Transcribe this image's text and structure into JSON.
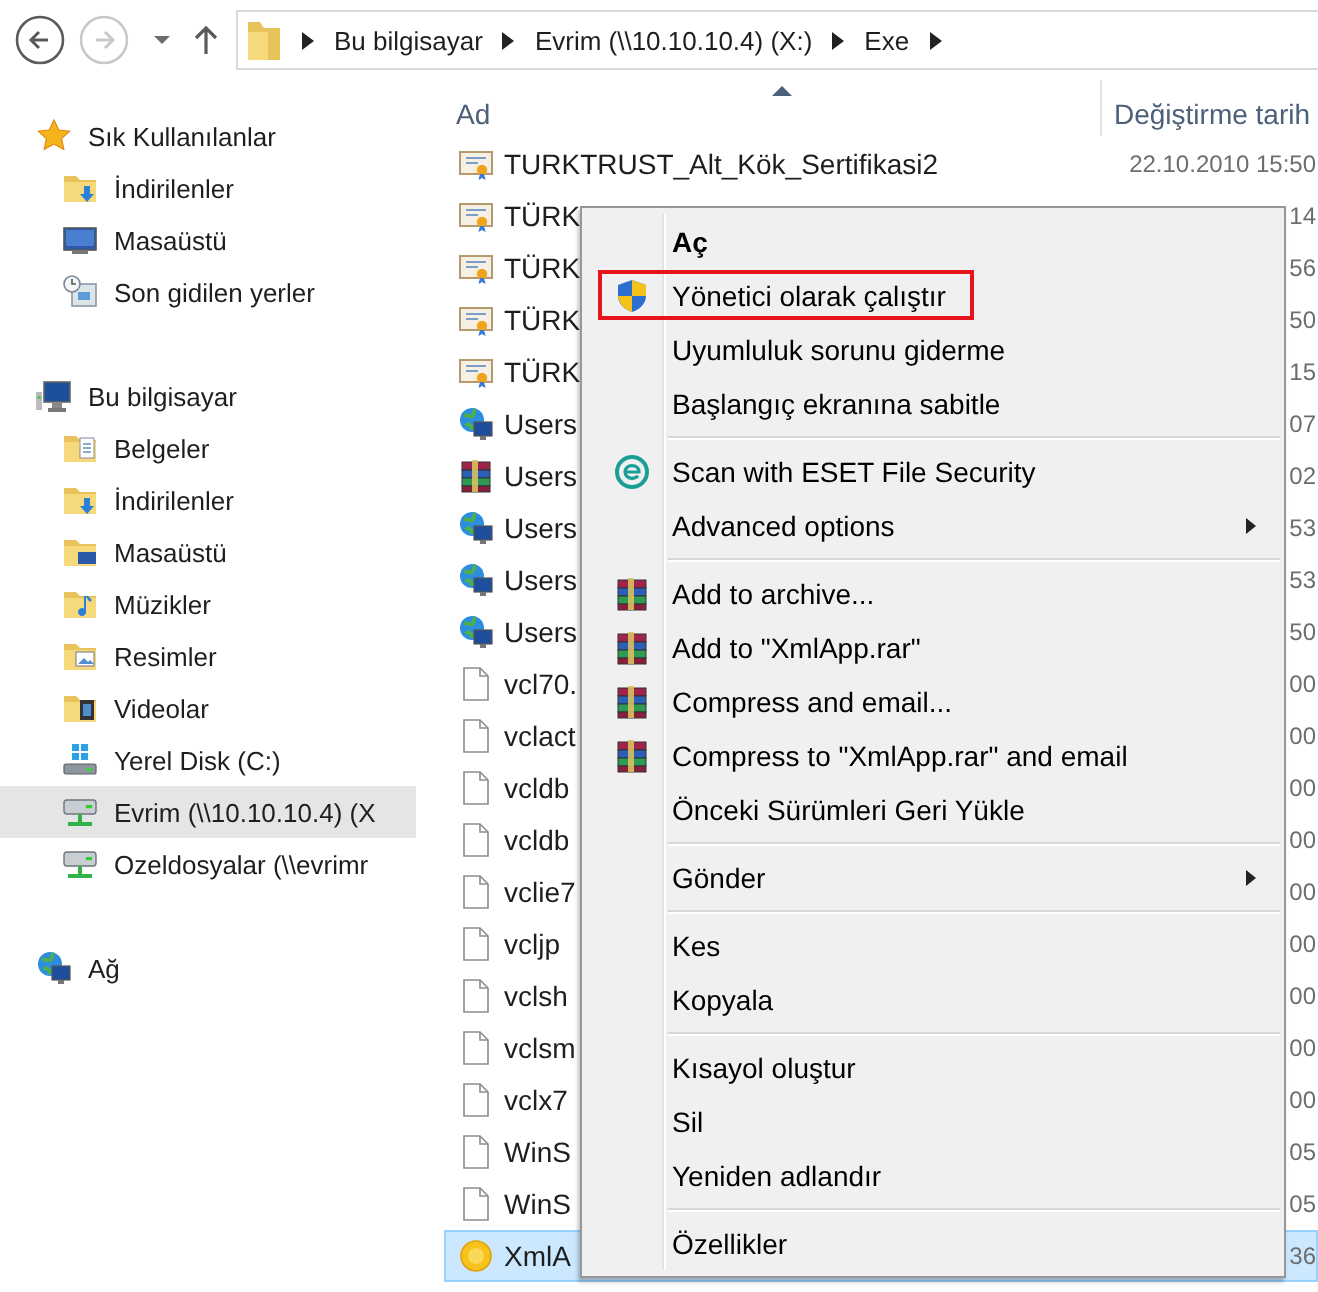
{
  "toolbar": {
    "nav": [
      {
        "kind": "back",
        "disabled": false
      },
      {
        "kind": "forward",
        "disabled": true
      }
    ],
    "address": {
      "crumbs": [
        "Bu bilgisayar",
        "Evrim (\\\\10.10.10.4) (X:)",
        "Exe"
      ]
    }
  },
  "sidebar": {
    "groups": [
      {
        "label": "Sık Kullanılanlar",
        "kind": "star",
        "selected": false,
        "children": [
          {
            "label": "İndirilenler",
            "kind": "downloads",
            "selected": false
          },
          {
            "label": "Masaüstü",
            "kind": "desktop",
            "selected": false
          },
          {
            "label": "Son gidilen yerler",
            "kind": "recent",
            "selected": false
          }
        ]
      },
      {
        "label": "Bu bilgisayar",
        "kind": "computer",
        "selected": false,
        "children": [
          {
            "label": "Belgeler",
            "kind": "documents",
            "selected": false
          },
          {
            "label": "İndirilenler",
            "kind": "downloads",
            "selected": false
          },
          {
            "label": "Masaüstü",
            "kind": "desktopfolder",
            "selected": false
          },
          {
            "label": "Müzikler",
            "kind": "music",
            "selected": false
          },
          {
            "label": "Resimler",
            "kind": "pictures",
            "selected": false
          },
          {
            "label": "Videolar",
            "kind": "videos",
            "selected": false
          },
          {
            "label": "Yerel Disk (C:)",
            "kind": "disk",
            "selected": false
          },
          {
            "label": "Evrim (\\\\10.10.10.4) (X",
            "kind": "netdrive",
            "selected": true
          },
          {
            "label": "Ozeldosyalar (\\\\evrimr",
            "kind": "netdrive",
            "selected": false
          }
        ]
      },
      {
        "label": "Ağ",
        "kind": "network",
        "selected": false
      }
    ]
  },
  "files": {
    "columns": [
      {
        "label": "Ad",
        "sorted": true
      },
      {
        "label": "Değiştirme tarih",
        "sorted": false
      }
    ],
    "rows": [
      {
        "name": "TURKTRUST_Alt_Kök_Sertifikasi2",
        "date": "22.10.2010 15:50",
        "kind": "cert",
        "selected": false
      },
      {
        "name": "TÜRK",
        "date": "14",
        "kind": "cert",
        "selected": false
      },
      {
        "name": "TÜRK",
        "date": "56",
        "kind": "cert",
        "selected": false
      },
      {
        "name": "TÜRK",
        "date": "50",
        "kind": "cert",
        "selected": false
      },
      {
        "name": "TÜRK",
        "date": "15",
        "kind": "cert",
        "selected": false
      },
      {
        "name": "Users",
        "date": "07",
        "kind": "network",
        "selected": false
      },
      {
        "name": "Users",
        "date": "02",
        "kind": "rar",
        "selected": false
      },
      {
        "name": "Users",
        "date": "53",
        "kind": "network",
        "selected": false
      },
      {
        "name": "Users",
        "date": "53",
        "kind": "network",
        "selected": false
      },
      {
        "name": "Users",
        "date": "50",
        "kind": "network",
        "selected": false
      },
      {
        "name": "vcl70.",
        "date": "00",
        "kind": "file",
        "selected": false
      },
      {
        "name": "vclact",
        "date": "00",
        "kind": "file",
        "selected": false
      },
      {
        "name": "vcldb",
        "date": "00",
        "kind": "file",
        "selected": false
      },
      {
        "name": "vcldb",
        "date": "00",
        "kind": "file",
        "selected": false
      },
      {
        "name": "vclie7",
        "date": "00",
        "kind": "file",
        "selected": false
      },
      {
        "name": "vcljp",
        "date": "00",
        "kind": "file",
        "selected": false
      },
      {
        "name": "vclsh",
        "date": "00",
        "kind": "file",
        "selected": false
      },
      {
        "name": "vclsm",
        "date": "00",
        "kind": "file",
        "selected": false
      },
      {
        "name": "vclx7",
        "date": "00",
        "kind": "file",
        "selected": false
      },
      {
        "name": "WinS",
        "date": "05",
        "kind": "file",
        "selected": false
      },
      {
        "name": "WinS",
        "date": "05",
        "kind": "file",
        "selected": false
      },
      {
        "name": "XmlA",
        "date": "36",
        "kind": "xml",
        "selected": true
      }
    ]
  },
  "menu": {
    "items": [
      {
        "kind": "plain",
        "label": "Aç",
        "default": true,
        "submenu": false,
        "highlighted": false
      },
      {
        "kind": "shield",
        "label": "Yönetici olarak çalıştır",
        "default": false,
        "submenu": false,
        "highlighted": true
      },
      {
        "kind": "plain",
        "label": "Uyumluluk sorunu giderme",
        "default": false,
        "submenu": false,
        "highlighted": false
      },
      {
        "kind": "plain",
        "label": "Başlangıç ekranına sabitle",
        "default": false,
        "submenu": false,
        "highlighted": false
      },
      {
        "kind": "separator"
      },
      {
        "kind": "eset",
        "label": "Scan with ESET File Security",
        "default": false,
        "submenu": false,
        "highlighted": false
      },
      {
        "kind": "plain",
        "label": "Advanced options",
        "default": false,
        "submenu": true,
        "highlighted": false
      },
      {
        "kind": "separator"
      },
      {
        "kind": "rar",
        "label": "Add to archive...",
        "default": false,
        "submenu": false,
        "highlighted": false
      },
      {
        "kind": "rar",
        "label": "Add to \"XmlApp.rar\"",
        "default": false,
        "submenu": false,
        "highlighted": false
      },
      {
        "kind": "rar",
        "label": "Compress and email...",
        "default": false,
        "submenu": false,
        "highlighted": false
      },
      {
        "kind": "rar",
        "label": "Compress to \"XmlApp.rar\" and email",
        "default": false,
        "submenu": false,
        "highlighted": false
      },
      {
        "kind": "plain",
        "label": "Önceki Sürümleri Geri Yükle",
        "default": false,
        "submenu": false,
        "highlighted": false
      },
      {
        "kind": "separator"
      },
      {
        "kind": "plain",
        "label": "Gönder",
        "default": false,
        "submenu": true,
        "highlighted": false
      },
      {
        "kind": "separator"
      },
      {
        "kind": "plain",
        "label": "Kes",
        "default": false,
        "submenu": false,
        "highlighted": false
      },
      {
        "kind": "plain",
        "label": "Kopyala",
        "default": false,
        "submenu": false,
        "highlighted": false
      },
      {
        "kind": "separator"
      },
      {
        "kind": "plain",
        "label": "Kısayol oluştur",
        "default": false,
        "submenu": false,
        "highlighted": false
      },
      {
        "kind": "plain",
        "label": "Sil",
        "default": false,
        "submenu": false,
        "highlighted": false
      },
      {
        "kind": "plain",
        "label": "Yeniden adlandır",
        "default": false,
        "submenu": false,
        "highlighted": false
      },
      {
        "kind": "separator"
      },
      {
        "kind": "plain",
        "label": "Özellikler",
        "default": false,
        "submenu": false,
        "highlighted": false
      }
    ]
  }
}
